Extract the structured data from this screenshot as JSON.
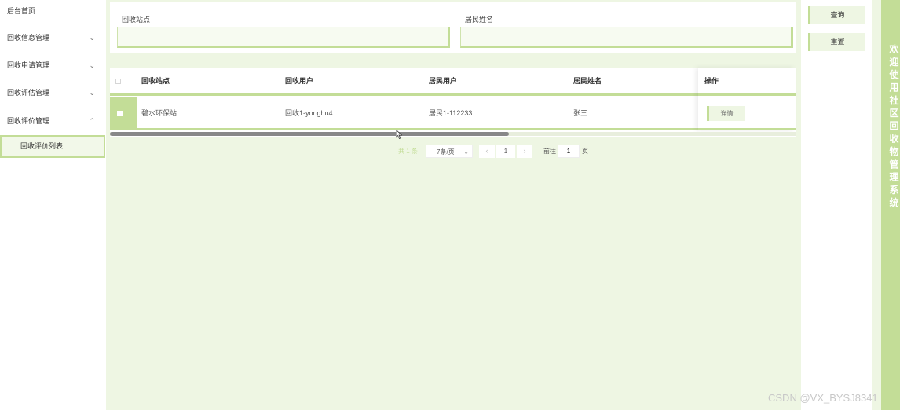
{
  "sidebar": {
    "items": [
      {
        "label": "后台首页",
        "has_chevron": false
      },
      {
        "label": "回收信息管理",
        "chevron": "⌄"
      },
      {
        "label": "回收申请管理",
        "chevron": "⌄"
      },
      {
        "label": "回收评估管理",
        "chevron": "⌄"
      },
      {
        "label": "回收评价管理",
        "chevron": "⌃"
      }
    ],
    "sub_item": "回收评价列表"
  },
  "search": {
    "station_label": "回收站点",
    "station_value": "",
    "resident_label": "居民姓名",
    "resident_value": ""
  },
  "table": {
    "headers": [
      "回收站点",
      "回收用户",
      "居民用户",
      "居民姓名",
      "操作"
    ],
    "rows": [
      {
        "station": "碧水环保站",
        "user": "回收1-yonghu4",
        "resident_user": "居民1-112233",
        "resident_name": "张三",
        "action": "详情"
      }
    ]
  },
  "pagination": {
    "total": "共 1 条",
    "page_size": "7条/页",
    "current_page": "1",
    "goto_label": "前往",
    "goto_value": "1",
    "page_suffix": "页",
    "prev_icon": "‹",
    "next_icon": "›",
    "chevron": "⌄"
  },
  "actions": {
    "query": "查询",
    "reset": "重置"
  },
  "vertical_title": "欢迎使用社区回收物管理系统",
  "watermark": "CSDN @VX_BYSJ8341",
  "colors": {
    "accent": "#c3dd97",
    "main_bg": "#eef6e3"
  }
}
